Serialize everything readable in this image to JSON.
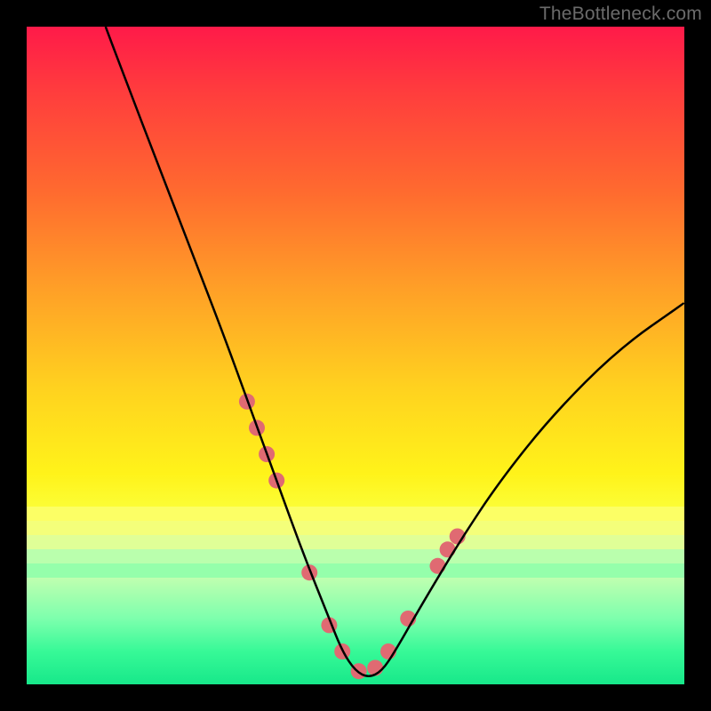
{
  "watermark": "TheBottleneck.com",
  "chart_data": {
    "type": "line",
    "title": "",
    "xlabel": "",
    "ylabel": "",
    "xlim": [
      0,
      100
    ],
    "ylim": [
      0,
      100
    ],
    "series": [
      {
        "name": "bottleneck-curve",
        "x": [
          12,
          15,
          20,
          25,
          30,
          34,
          38,
          42,
          46,
          48,
          50,
          52,
          54,
          56,
          60,
          66,
          72,
          80,
          90,
          100
        ],
        "values": [
          100,
          92,
          79,
          66,
          53,
          42,
          31,
          20,
          10,
          5,
          2,
          1,
          2,
          5,
          12,
          22,
          31,
          41,
          51,
          58
        ]
      }
    ],
    "markers": {
      "name": "highlight-dots",
      "x": [
        33.5,
        35.0,
        36.5,
        38.0,
        43.0,
        46.0,
        48.0,
        50.5,
        53.0,
        55.0,
        58.0,
        62.5,
        64.0,
        65.5
      ],
      "values": [
        43.0,
        39.0,
        35.0,
        31.0,
        17.0,
        9.0,
        5.0,
        2.0,
        2.5,
        5.0,
        10.0,
        18.0,
        20.5,
        22.5
      ]
    },
    "background_bands": [
      {
        "y_from": 100,
        "y_to": 27,
        "color": "gradient-red-yellow"
      },
      {
        "y_from": 27,
        "y_to": 25,
        "color": "#fcff65"
      },
      {
        "y_from": 25,
        "y_to": 23,
        "color": "#f4ff7a"
      },
      {
        "y_from": 23,
        "y_to": 21,
        "color": "#e0ff97"
      },
      {
        "y_from": 21,
        "y_to": 19,
        "color": "#baffad"
      },
      {
        "y_from": 19,
        "y_to": 17,
        "color": "#95ffab"
      },
      {
        "y_from": 17,
        "y_to": 0,
        "color": "gradient-green"
      }
    ],
    "marker_style": {
      "color": "#e06a72",
      "radius": 9
    },
    "curve_style": {
      "stroke": "#000000",
      "width": 2.5
    }
  }
}
